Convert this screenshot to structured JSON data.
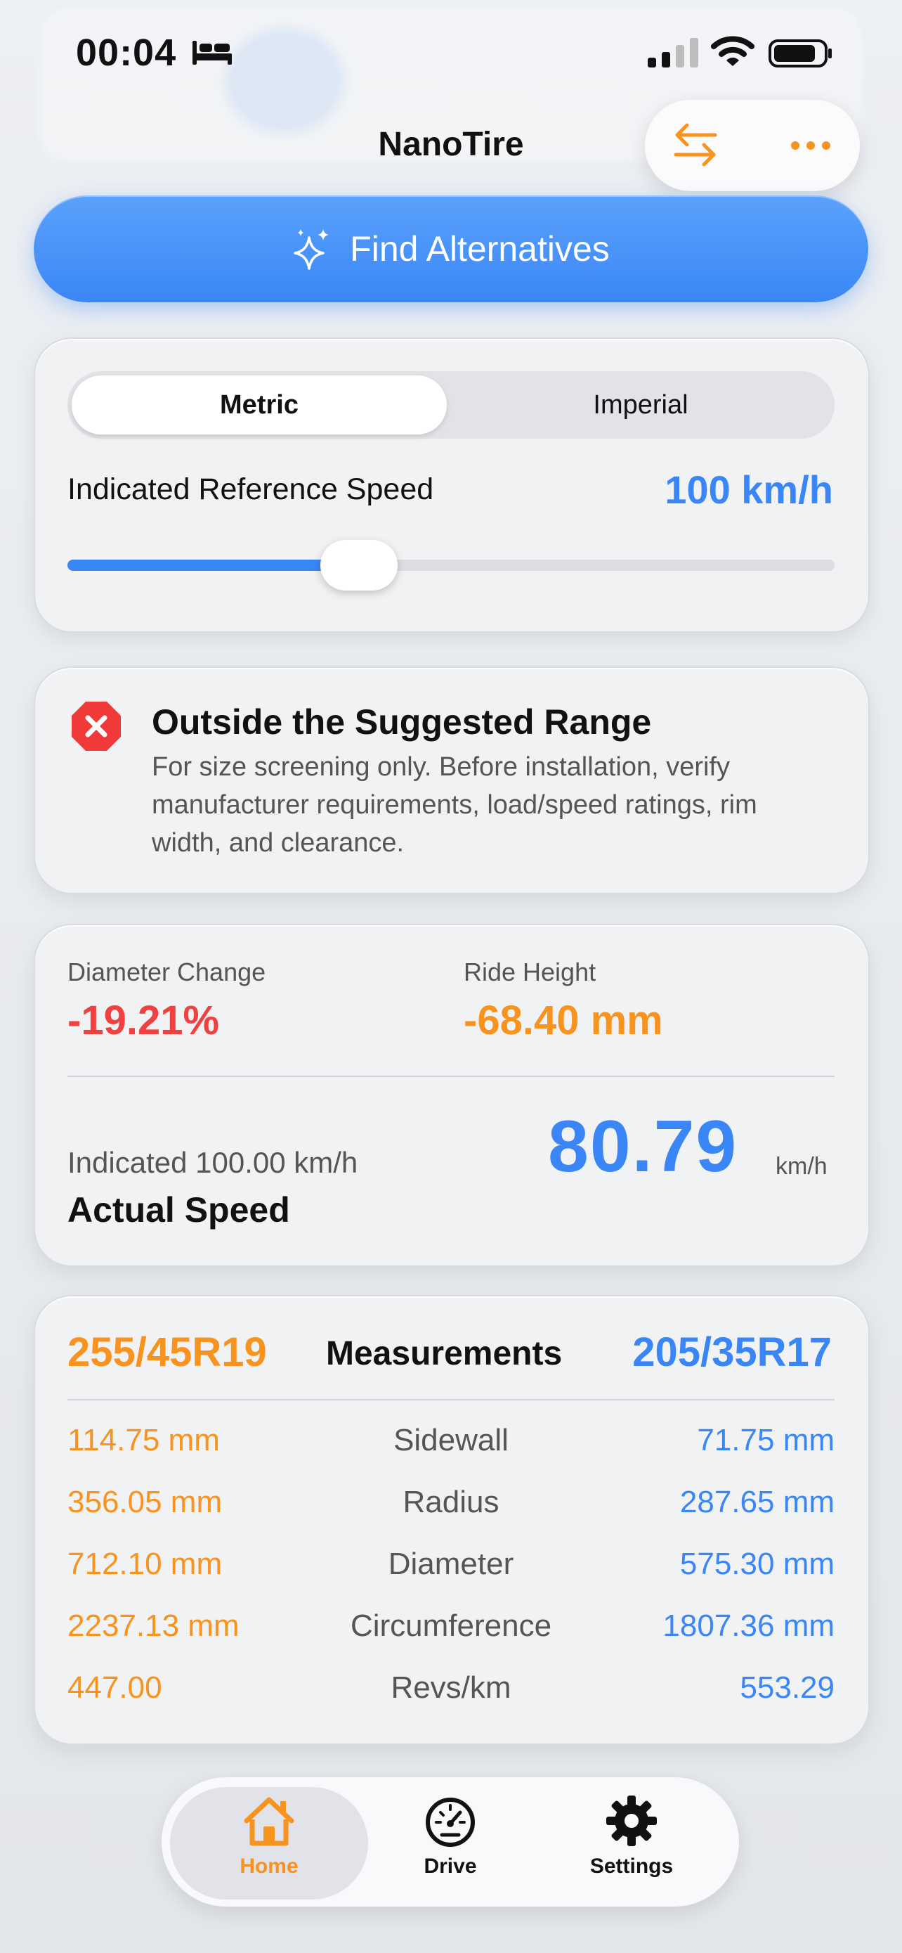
{
  "status_bar": {
    "time": "00:04"
  },
  "header": {
    "title": "NanoTire"
  },
  "actions": {
    "find_alternatives": "Find Alternatives"
  },
  "units": {
    "metric": "Metric",
    "imperial": "Imperial",
    "selected": "Metric"
  },
  "reference_speed": {
    "label": "Indicated Reference Speed",
    "value": "100 km/h",
    "slider_level": 0.38
  },
  "warning": {
    "title": "Outside the Suggested Range",
    "body": "For size screening only. Before installation, verify manufacturer requirements, load/speed ratings, rim width, and clearance."
  },
  "results": {
    "diameter_change_label": "Diameter Change",
    "diameter_change_value": "-19.21%",
    "ride_height_label": "Ride Height",
    "ride_height_value": "-68.40 mm",
    "indicated": "Indicated 100.00 km/h",
    "actual_label": "Actual Speed",
    "actual_value": "80.79",
    "actual_unit": "km/h"
  },
  "measurements": {
    "left_size": "255/45R19",
    "title": "Measurements",
    "right_size": "205/35R17",
    "rows": [
      {
        "left": "114.75 mm",
        "name": "Sidewall",
        "right": "71.75 mm"
      },
      {
        "left": "356.05 mm",
        "name": "Radius",
        "right": "287.65 mm"
      },
      {
        "left": "712.10 mm",
        "name": "Diameter",
        "right": "575.30 mm"
      },
      {
        "left": "2237.13 mm",
        "name": "Circumference",
        "right": "1807.36 mm"
      },
      {
        "left": "447.00",
        "name": "Revs/km",
        "right": "553.29"
      }
    ]
  },
  "tabs": [
    {
      "label": "Home",
      "icon": "house-icon",
      "active": true
    },
    {
      "label": "Drive",
      "icon": "speedometer-icon",
      "active": false
    },
    {
      "label": "Settings",
      "icon": "gear-icon",
      "active": false
    }
  ],
  "colors": {
    "accent_blue": "#3b86f6",
    "accent_orange": "#f7931e",
    "error_red": "#f04040"
  }
}
